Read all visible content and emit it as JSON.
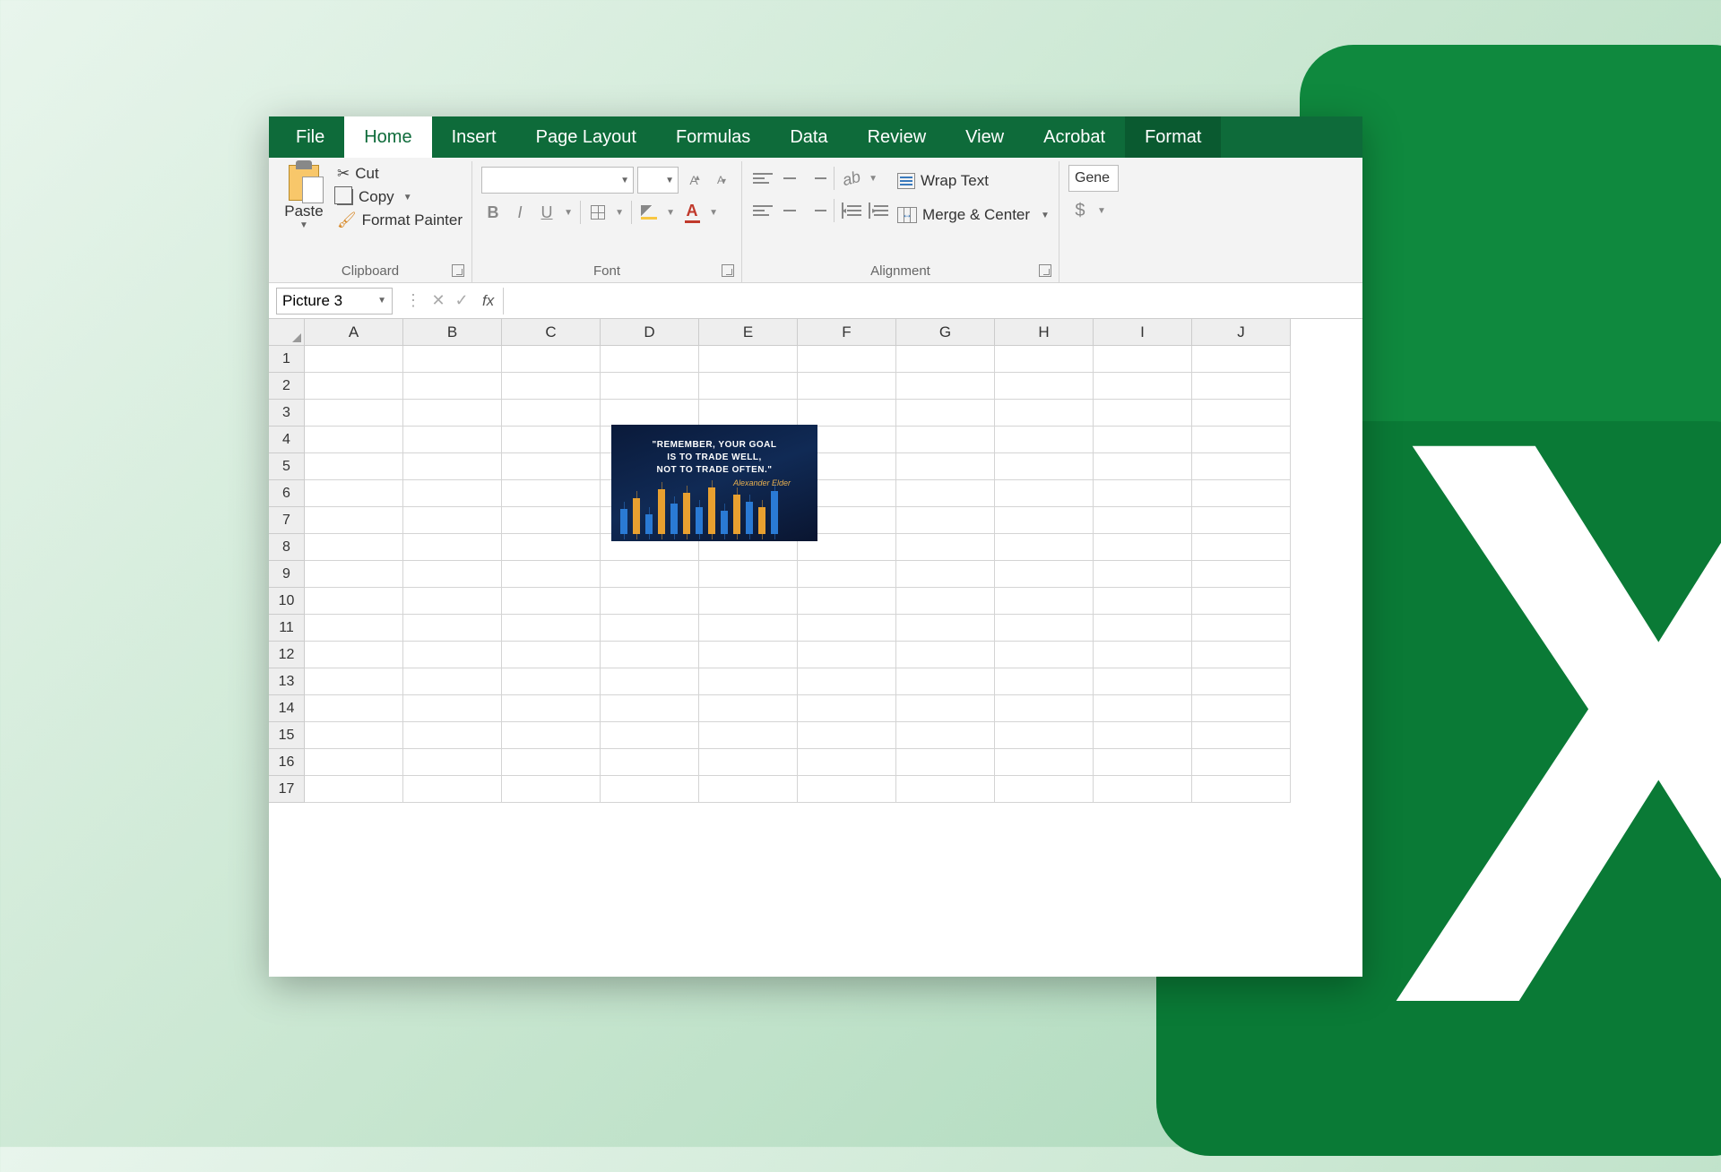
{
  "tabs": [
    "File",
    "Home",
    "Insert",
    "Page Layout",
    "Formulas",
    "Data",
    "Review",
    "View",
    "Acrobat",
    "Format"
  ],
  "active_tab": "Home",
  "ribbon": {
    "clipboard": {
      "label": "Clipboard",
      "paste": "Paste",
      "cut": "Cut",
      "copy": "Copy",
      "painter": "Format Painter"
    },
    "font": {
      "label": "Font"
    },
    "alignment": {
      "label": "Alignment",
      "wrap": "Wrap Text",
      "merge": "Merge & Center"
    },
    "number": {
      "format": "Gene"
    }
  },
  "formula_bar": {
    "name_box": "Picture 3",
    "fx": "fx"
  },
  "grid": {
    "columns": [
      "A",
      "B",
      "C",
      "D",
      "E",
      "F",
      "G",
      "H",
      "I",
      "J"
    ],
    "rows": [
      1,
      2,
      3,
      4,
      5,
      6,
      7,
      8,
      9,
      10,
      11,
      12,
      13,
      14,
      15,
      16,
      17
    ]
  },
  "picture": {
    "line1": "\"REMEMBER, YOUR GOAL",
    "line2": "IS TO TRADE WELL,",
    "line3": "NOT TO TRADE OFTEN.\"",
    "signature": "Alexander Elder"
  }
}
